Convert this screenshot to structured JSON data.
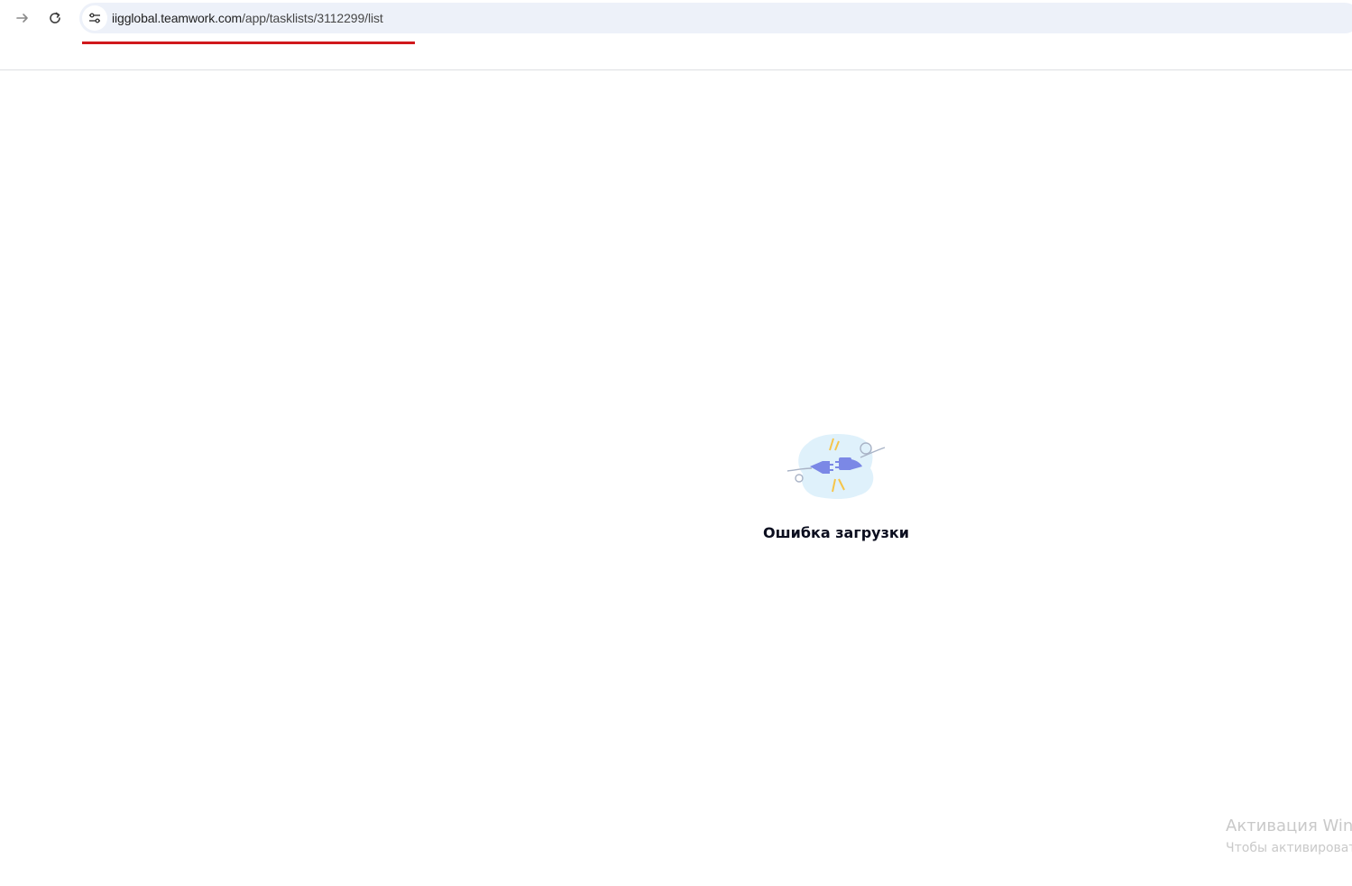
{
  "browser": {
    "url_host": "iigglobal.teamwork.com",
    "url_path": "/app/tasklists/3112299/list",
    "icons": {
      "forward": "arrow-right-icon",
      "reload": "reload-icon",
      "site_info": "tune-icon"
    },
    "accent_underline_color": "#d0181c"
  },
  "page": {
    "error_title": "Ошибка загрузки",
    "illustration": "unplugged-cable-icon"
  },
  "watermark": {
    "title": "Активация Wind",
    "subtitle": "Чтобы активировать"
  }
}
